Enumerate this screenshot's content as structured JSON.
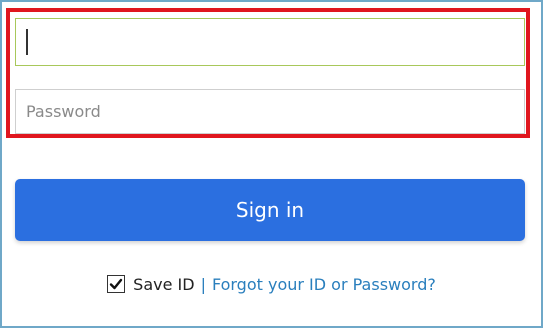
{
  "login": {
    "id_value": "",
    "password_placeholder": "Password",
    "sign_in_label": "Sign in",
    "save_id_label": "Save ID",
    "save_id_checked": true,
    "divider": "|",
    "forgot_label": "Forgot your ID or Password?"
  },
  "colors": {
    "highlight_border": "#e0161e",
    "button_bg": "#2b6fe0",
    "link": "#2a7fbd",
    "frame_border": "#6fa8c8",
    "focused_input_border": "#a8c85a"
  },
  "icons": {
    "checkbox": "checkmark-icon"
  }
}
